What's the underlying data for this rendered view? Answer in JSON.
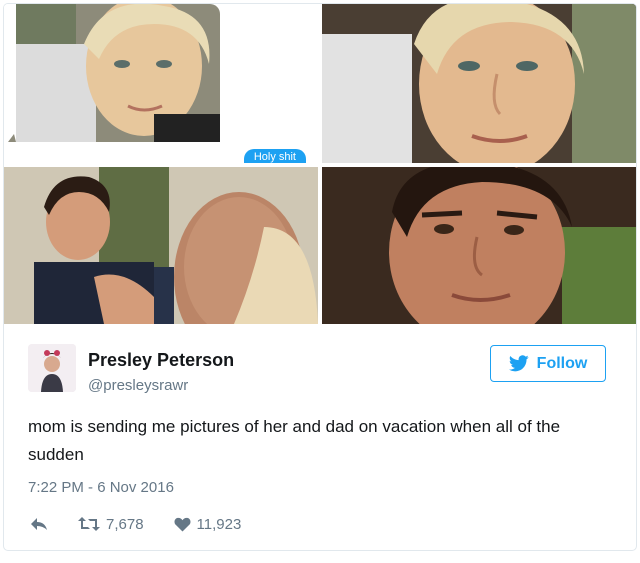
{
  "grid": {
    "message_bubble": "Holy shit"
  },
  "tweet": {
    "display_name": "Presley Peterson",
    "handle": "@presleysrawr",
    "follow_label": "Follow",
    "text": "mom is sending me pictures of her and dad on vacation when all of the sudden",
    "timestamp": "7:22 PM - 6 Nov 2016",
    "retweets": "7,678",
    "likes": "11,923"
  },
  "colors": {
    "brand": "#1da1f2",
    "muted": "#657786",
    "text": "#14171a",
    "border": "#e1e8ed"
  },
  "icons": [
    "twitter-bird-icon",
    "reply-icon",
    "retweet-icon",
    "heart-icon"
  ]
}
